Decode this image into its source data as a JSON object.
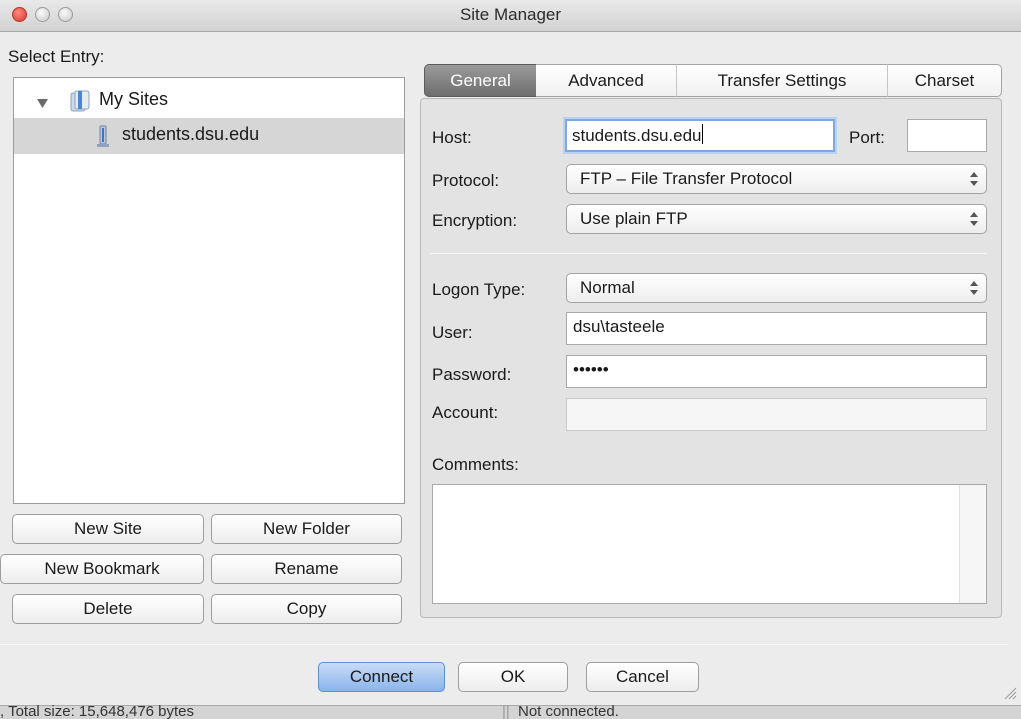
{
  "window": {
    "title": "Site Manager"
  },
  "left": {
    "select_entry_label": "Select Entry:",
    "tree": {
      "root_label": "My Sites",
      "root_icon": "folder-icon",
      "site_label": "students.dsu.edu",
      "site_icon": "server-icon"
    },
    "buttons": {
      "new_site": "New Site",
      "new_folder": "New Folder",
      "new_bookmark": "New Bookmark",
      "rename": "Rename",
      "delete": "Delete",
      "copy": "Copy"
    }
  },
  "tabs": [
    {
      "label": "General",
      "selected": true
    },
    {
      "label": "Advanced",
      "selected": false
    },
    {
      "label": "Transfer Settings",
      "selected": false
    },
    {
      "label": "Charset",
      "selected": false
    }
  ],
  "general": {
    "host_label": "Host:",
    "host_value": "students.dsu.edu",
    "port_label": "Port:",
    "port_value": "",
    "protocol_label": "Protocol:",
    "protocol_value": "FTP – File Transfer Protocol",
    "encryption_label": "Encryption:",
    "encryption_value": "Use plain FTP",
    "logon_type_label": "Logon Type:",
    "logon_type_value": "Normal",
    "user_label": "User:",
    "user_value": "dsu\\tasteele",
    "password_label": "Password:",
    "password_value": "••••••",
    "account_label": "Account:",
    "account_value": "",
    "comments_label": "Comments:",
    "comments_value": ""
  },
  "footer": {
    "connect": "Connect",
    "ok": "OK",
    "cancel": "Cancel"
  },
  "status": {
    "left_text": ", Total size: 15,648,476 bytes",
    "right_text": "Not connected."
  },
  "colors": {
    "tab_selected": "#7d7d7d",
    "connect_accent": "#8ab4ec",
    "focus_ring": "#7fa8e3"
  }
}
